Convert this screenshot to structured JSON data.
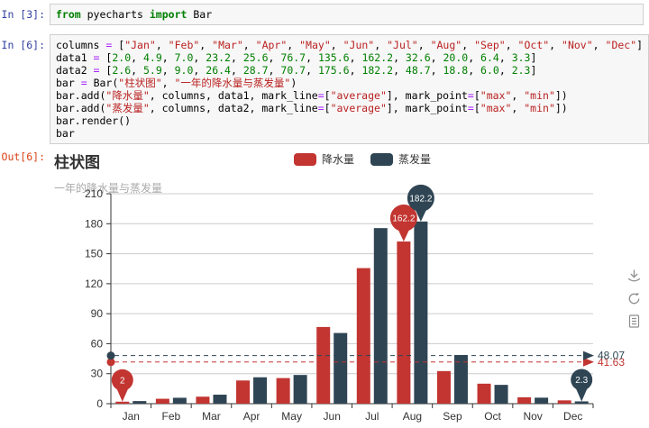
{
  "notebook": {
    "cells": [
      {
        "prompt": "In [3]:",
        "code": [
          "from pyecharts import Bar"
        ]
      },
      {
        "prompt": "In [6]:",
        "code": [
          "columns = [\"Jan\", \"Feb\", \"Mar\", \"Apr\", \"May\", \"Jun\", \"Jul\", \"Aug\", \"Sep\", \"Oct\", \"Nov\", \"Dec\"]",
          "data1 = [2.0, 4.9, 7.0, 23.2, 25.6, 76.7, 135.6, 162.2, 32.6, 20.0, 6.4, 3.3]",
          "data2 = [2.6, 5.9, 9.0, 26.4, 28.7, 70.7, 175.6, 182.2, 48.7, 18.8, 6.0, 2.3]",
          "bar = Bar(\"柱状图\", \"一年的降水量与蒸发量\")",
          "bar.add(\"降水量\", columns, data1, mark_line=[\"average\"], mark_point=[\"max\", \"min\"])",
          "bar.add(\"蒸发量\", columns, data2, mark_line=[\"average\"], mark_point=[\"max\", \"min\"])",
          "bar.render()",
          "bar"
        ]
      }
    ],
    "output_prompt": "Out[6]:"
  },
  "chart_data": {
    "type": "bar",
    "title": "柱状图",
    "subtitle": "一年的降水量与蒸发量",
    "categories": [
      "Jan",
      "Feb",
      "Mar",
      "Apr",
      "May",
      "Jun",
      "Jul",
      "Aug",
      "Sep",
      "Oct",
      "Nov",
      "Dec"
    ],
    "series": [
      {
        "name": "降水量",
        "color": "#c23531",
        "values": [
          2.0,
          4.9,
          7.0,
          23.2,
          25.6,
          76.7,
          135.6,
          162.2,
          32.6,
          20.0,
          6.4,
          3.3
        ],
        "average": 41.63,
        "average_label": "41.63",
        "max": 162.2,
        "max_label": "162.2",
        "min": 2.0,
        "min_label": "2"
      },
      {
        "name": "蒸发量",
        "color": "#2f4554",
        "values": [
          2.6,
          5.9,
          9.0,
          26.4,
          28.7,
          70.7,
          175.6,
          182.2,
          48.7,
          18.8,
          6.0,
          2.3
        ],
        "average": 48.07,
        "average_label": "48.07",
        "max": 182.2,
        "max_label": "182.2",
        "min": 2.3,
        "min_label": "2.3"
      }
    ],
    "ylim": [
      0,
      210
    ],
    "ytick_step": 30,
    "grid": true,
    "legend_position": "top-center",
    "mark_lines": "average (dashed, arrow + value label at right)",
    "toolbox": [
      "download-icon",
      "refresh-icon",
      "data-view-icon"
    ]
  },
  "colors": {
    "series_rain": "#c23531",
    "series_evap": "#2f4554",
    "in_prompt": "#303f9f",
    "out_prompt": "#d84315",
    "keyword": "#008000",
    "string": "#ba2121",
    "number": "#008000",
    "operator": "#aa22ff",
    "axis": "#333333",
    "gridline": "#cccccc",
    "subtitle": "#aaaaaa"
  }
}
